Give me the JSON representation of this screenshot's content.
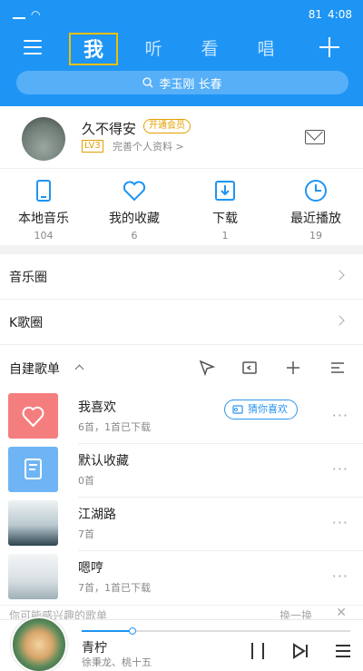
{
  "status": {
    "time": "4:08",
    "battery": "81"
  },
  "tabs": [
    {
      "label": "我"
    },
    {
      "label": "听"
    },
    {
      "label": "看"
    },
    {
      "label": "唱"
    }
  ],
  "search": {
    "placeholder": "李玉刚 长春"
  },
  "profile": {
    "nickname": "久不得安",
    "vip_badge": "开通会员",
    "level": "LV3",
    "complete_text": "完善个人资料 >"
  },
  "quick_items": [
    {
      "label": "本地音乐",
      "count": "104",
      "icon": "phone-icon"
    },
    {
      "label": "我的收藏",
      "count": "6",
      "icon": "heart-icon"
    },
    {
      "label": "下载",
      "count": "1",
      "icon": "download-icon"
    },
    {
      "label": "最近播放",
      "count": "19",
      "icon": "clock-icon"
    }
  ],
  "rows": [
    {
      "label": "音乐圈"
    },
    {
      "label": "K歌圈"
    }
  ],
  "playlists_section": {
    "title": "自建歌单"
  },
  "playlists": [
    {
      "name": "我喜欢",
      "sub": "6首，1首已下载",
      "cover_color": "#f47e7e"
    },
    {
      "name": "默认收藏",
      "sub": "0首",
      "cover_color": "#6fb5f5"
    },
    {
      "name": "江湖路",
      "sub": "7首",
      "cover_color": "#dfe7ea"
    },
    {
      "name": "嗯哼",
      "sub": "7首，1首已下载",
      "cover_color": "#e8eef0"
    }
  ],
  "guess_button": {
    "label": "猜你喜欢"
  },
  "recommend": {
    "text": "你可能感兴趣的歌单",
    "switch_label": "换一换"
  },
  "player": {
    "song": "青柠",
    "artist": "徐秉龙、桃十五",
    "progress": 0.19
  },
  "colors": {
    "accent": "#1e95f5",
    "vip": "#e3a000"
  }
}
